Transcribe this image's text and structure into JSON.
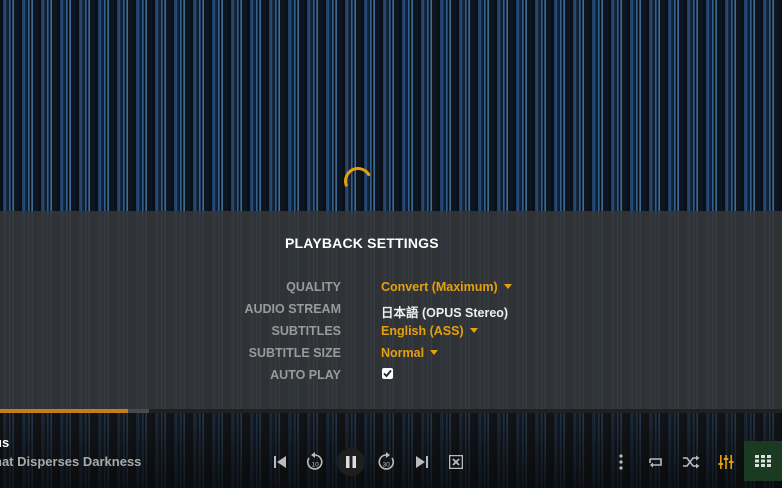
{
  "settings": {
    "title": "PLAYBACK SETTINGS",
    "rows": [
      {
        "label": "QUALITY",
        "value": "Convert (Maximum)",
        "dropdown": true
      },
      {
        "label": "AUDIO STREAM",
        "value": "日本語 (OPUS Stereo)",
        "dropdown": false
      },
      {
        "label": "SUBTITLES",
        "value": "English (ASS)",
        "dropdown": true
      },
      {
        "label": "SUBTITLE SIZE",
        "value": "Normal",
        "dropdown": true
      },
      {
        "label": "AUTO PLAY",
        "checked": true
      }
    ]
  },
  "player": {
    "title": "us",
    "subtitle": "hat Disperses Darkness",
    "progress_fraction": 0.164,
    "buffer_fraction": 0.19,
    "controls": {
      "previous": "skip-previous-icon",
      "rewind": "replay-10-icon",
      "pause": "pause-icon",
      "forward": "forward-30-icon",
      "next": "skip-next-icon",
      "stop": "stop-icon",
      "more": "more-vertical-icon",
      "repeat": "repeat-icon",
      "shuffle": "shuffle-icon",
      "equalizer": "equalizer-icon",
      "grid": "grid-icon"
    }
  },
  "colors": {
    "accent": "#e5a00d",
    "progress": "#cc7b19",
    "overlay": "#343638"
  }
}
